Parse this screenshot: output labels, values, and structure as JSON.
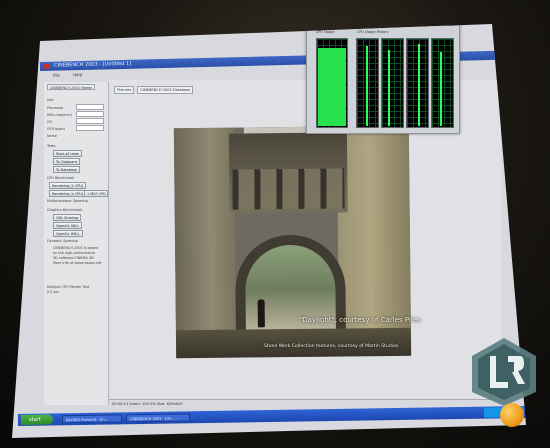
{
  "window": {
    "title": "CINEBENCH 2003 - [Untitled 1]"
  },
  "menu": [
    "File",
    "Help"
  ],
  "left_panel": {
    "tab": "CINEBENCH 2003 Viewer",
    "fields": [
      "Info",
      "Processor",
      "MHz (real/min)",
      "OS",
      "GFX board",
      "Name"
    ],
    "tests_label": "Tests",
    "buttons": {
      "start_all": "Start all tests",
      "to_clipboard": "To Clipboard",
      "to_database": "To Database",
      "rendering_1cpu": "Rendering (1 CPU)",
      "rendering_xcpu": "Rendering (x CPU)",
      "cpu_count": "1 MCF CPU",
      "ogl_shading": "OGL Shading",
      "opengl_sw": "OpenGL SW-L",
      "opengl_hw": "OpenGL HW-L"
    },
    "cpu_benchmark_label": "CPU Benchmark",
    "multiprocessor_label": "Multiprocessor Speedup",
    "graphics_label": "Graphics Benchmark",
    "dynamic_label": "Dynamic Speedup",
    "info_lines": [
      "CINEBENCH 2003 is based",
      "on the high-performance",
      "3D software CINEMA 4D.",
      "More info at www.maxon.net"
    ],
    "render_time_label": "Multiple CPU Render Test",
    "render_time_value": "0.0 sec"
  },
  "tabs": [
    "Pictures",
    "CINEBENCH 2003 Database"
  ],
  "render": {
    "caption_main": "\"Daylight\", courtesy of Carles Piles",
    "caption_sub": "Stone Work Collection textures, courtesy of Martin Studios"
  },
  "cpu_overlay": {
    "usage_label": "CPU Usage",
    "history_label": "CPU Usage History",
    "usage_value_label": "100 %",
    "history_graph_count": 4
  },
  "status_bar": {
    "text": "00:00:13   Zoom: 100.0%   Size: 629x629"
  },
  "taskbar": {
    "start_label": "start",
    "tasks": [
      "[NVIDIO Present] - [In...",
      "CINEBENCH 2003 - [Un..."
    ],
    "tray_text": "▶▶"
  },
  "colors": {
    "titlebar": "#2a4fa8",
    "taskbar": "#1d47b0",
    "start_button": "#2f8a2c",
    "cpu_graph_line": "#27e24c",
    "logo_ball": "#f0a01d"
  }
}
